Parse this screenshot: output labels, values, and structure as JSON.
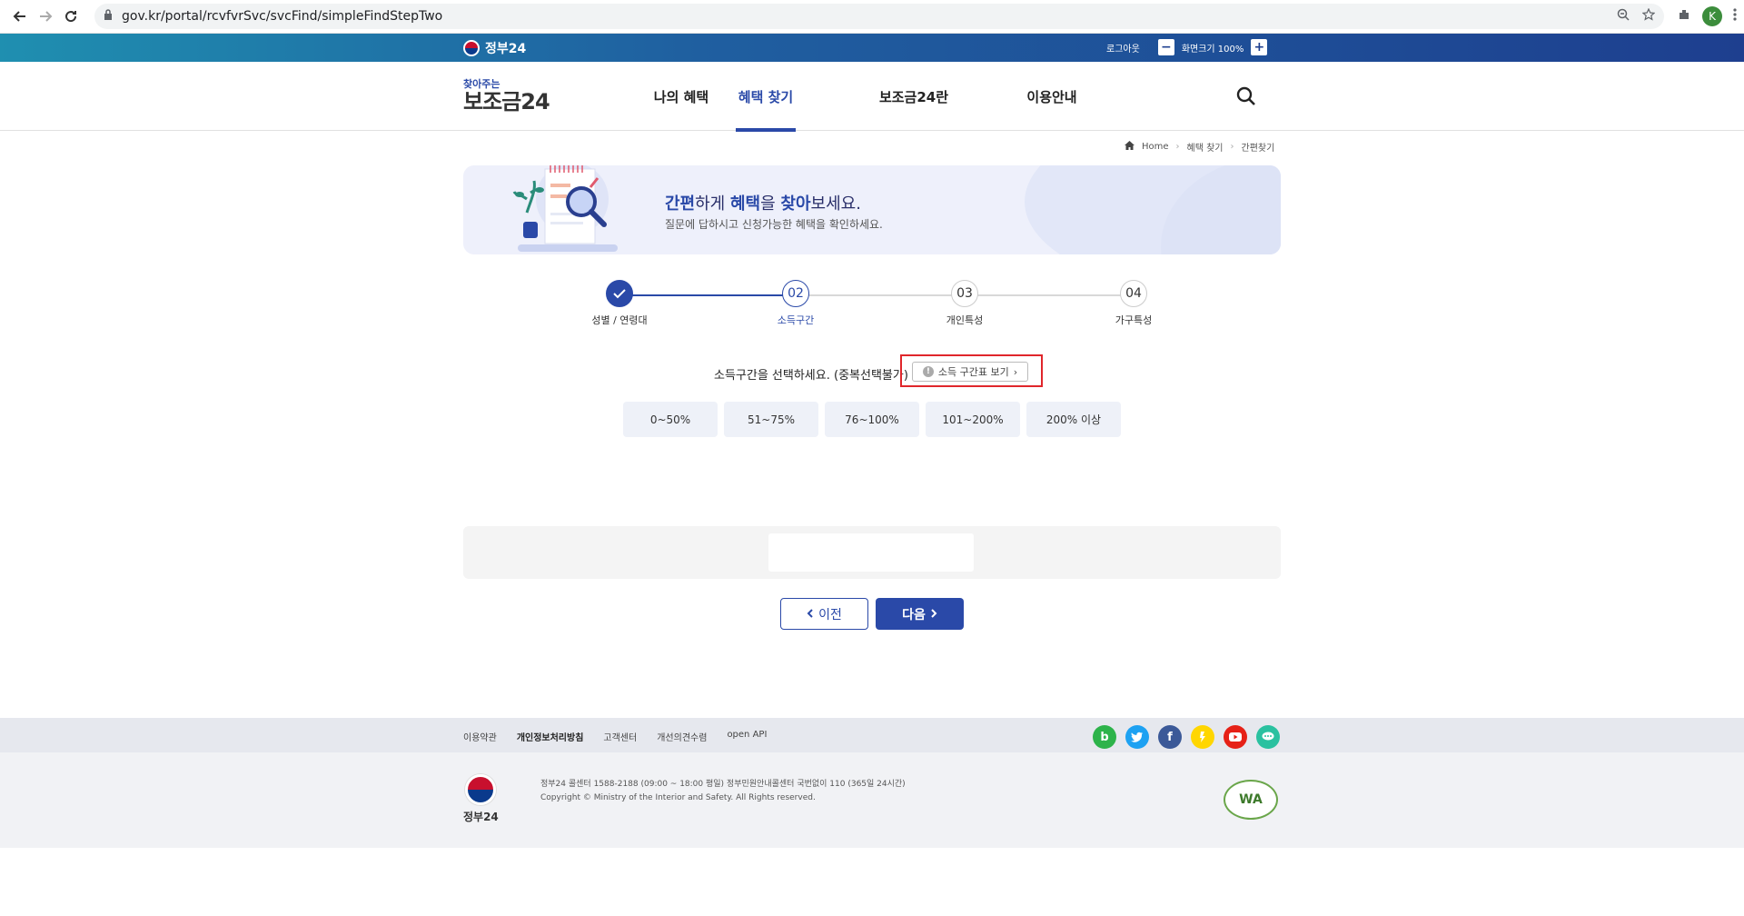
{
  "browser": {
    "url": "gov.kr/portal/rcvfvrSvc/svcFind/simpleFindStepTwo",
    "profile_initial": "K"
  },
  "govbar": {
    "logo": "정부24",
    "logout": "로그아웃",
    "zoom_label": "화면크기 100%",
    "minus": "−",
    "plus": "+"
  },
  "header": {
    "brand_small": "찾아주는",
    "brand_big": "보조금24",
    "menu": [
      {
        "label": "나의 혜택"
      },
      {
        "label": "혜택 찾기"
      },
      {
        "label": "보조금24란"
      },
      {
        "label": "이용안내"
      }
    ]
  },
  "breadcrumb": [
    "Home",
    "혜택 찾기",
    "간편찾기"
  ],
  "banner": {
    "title_1": "간편",
    "title_2": "하게 ",
    "title_3": "혜택",
    "title_4": "을 ",
    "title_5": "찾아",
    "title_6": "보세요.",
    "subtitle": "질문에 답하시고 신청가능한 혜택을 확인하세요."
  },
  "steps": [
    {
      "num": "",
      "label": "성별 / 연령대",
      "state": "done"
    },
    {
      "num": "02",
      "label": "소득구간",
      "state": "current"
    },
    {
      "num": "03",
      "label": "개인특성",
      "state": "todo"
    },
    {
      "num": "04",
      "label": "가구특성",
      "state": "todo"
    }
  ],
  "question": {
    "text": "소득구간을 선택하세요. (중복선택불가)",
    "chart_button": "소득 구간표 보기",
    "bang": "!"
  },
  "options": [
    "0~50%",
    "51~75%",
    "76~100%",
    "101~200%",
    "200% 이상"
  ],
  "buttons": {
    "prev": "이전",
    "next": "다음"
  },
  "footer": {
    "links": [
      "이용약관",
      "개인정보처리방침",
      "고객센터",
      "개선의견수렴",
      "open API"
    ],
    "logo_text": "정부24",
    "info_line1": "정부24 콜센터 1588-2188 (09:00 ~ 18:00 평일) 정부민원안내콜센터 국번없이 110 (365일 24시간)",
    "info_line2": "Copyright © Ministry of the Interior and Safety. All Rights reserved.",
    "wa": "WA"
  }
}
